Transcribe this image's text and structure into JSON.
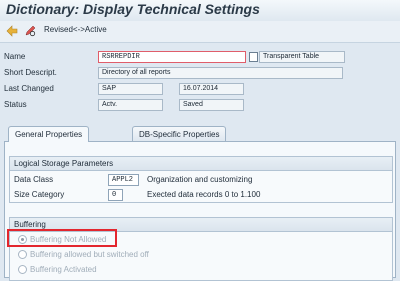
{
  "title": "Dictionary: Display Technical Settings",
  "toolbar": {
    "revised_active_label": "Revised<->Active"
  },
  "header": {
    "name_label": "Name",
    "name_value": "RSRREPDIR",
    "object_type": "Transparent Table",
    "short_desc_label": "Short Descript.",
    "short_desc_value": "Directory of all reports",
    "last_changed_label": "Last Changed",
    "last_changed_user": "SAP",
    "last_changed_date": "16.07.2014",
    "status_label": "Status",
    "status_value": "Actv.",
    "status_saved": "Saved"
  },
  "tabs": [
    {
      "label": "General Properties"
    },
    {
      "label": "DB-Specific Properties"
    }
  ],
  "logical_storage": {
    "title": "Logical Storage Parameters",
    "data_class_label": "Data Class",
    "data_class_value": "APPL2",
    "data_class_desc": "Organization and customizing",
    "size_category_label": "Size Category",
    "size_category_value": "0",
    "size_category_desc": "Exected data records 0 to 1.100"
  },
  "buffering": {
    "title": "Buffering",
    "options": [
      {
        "label": "Buffering Not Allowed"
      },
      {
        "label": "Buffering allowed but switched off"
      },
      {
        "label": "Buffering Activated"
      }
    ]
  },
  "colors": {
    "highlight": "#e3262e"
  }
}
